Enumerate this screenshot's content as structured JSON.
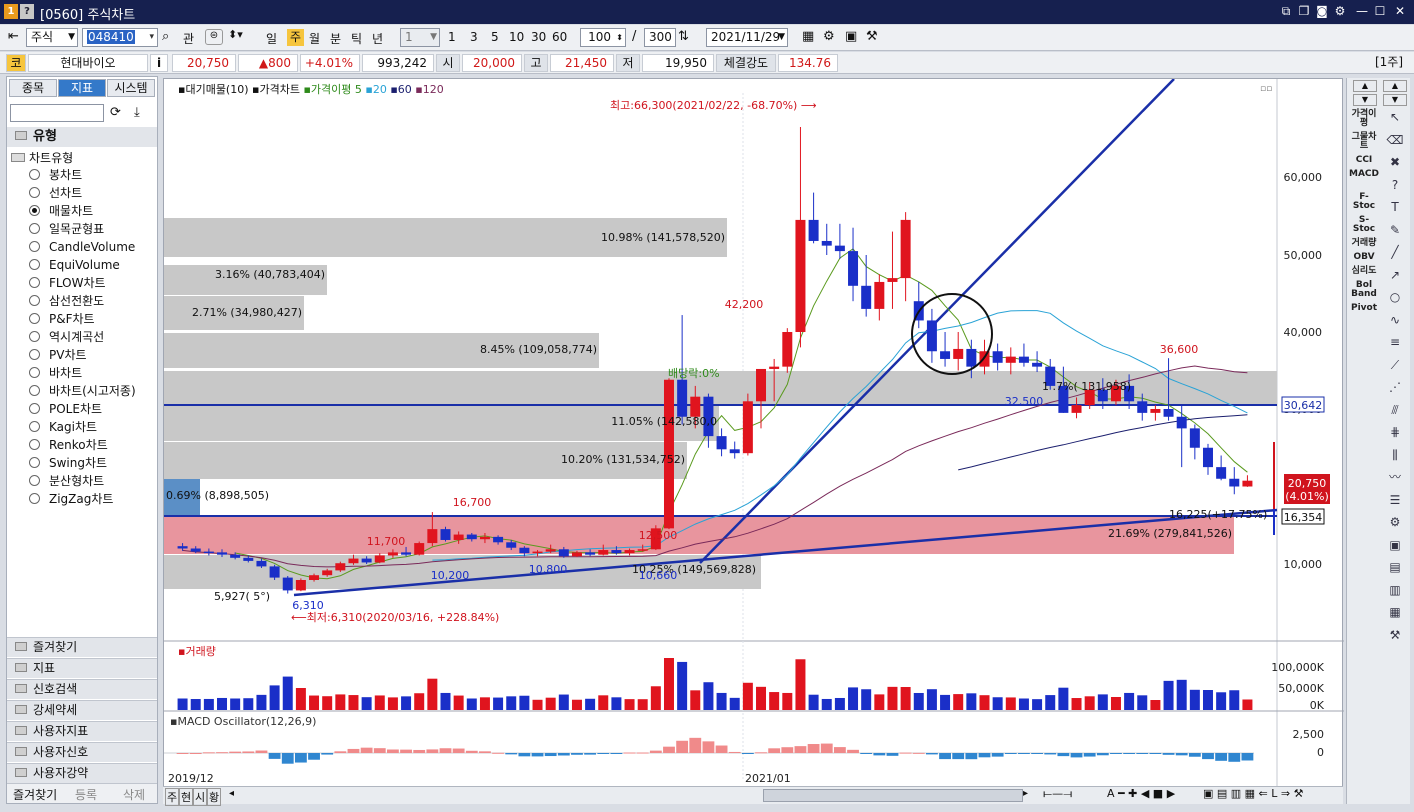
{
  "title": {
    "badge1": "1",
    "badge2": "?",
    "text": "[0560] 주식차트"
  },
  "toolbar": {
    "market": "주식",
    "code": "048410",
    "kwan": "관",
    "periods": [
      "일",
      "주",
      "월",
      "분",
      "틱",
      "년"
    ],
    "unit": "1",
    "quick": [
      "1",
      "3",
      "5",
      "10",
      "30",
      "60"
    ],
    "count": "100",
    "slash": "/",
    "total": "300",
    "date": "2021/11/29"
  },
  "quote": {
    "co_label": "코",
    "name": "현대바이오",
    "info": "i",
    "price": "20,750",
    "change": "▲800",
    "rate": "+4.01%",
    "volume": "993,242",
    "open_label": "시",
    "open": "20,000",
    "high_label": "고",
    "high": "21,450",
    "low_label": "저",
    "low": "19,950",
    "strength_label": "체결강도",
    "strength": "134.76",
    "period_tag": "[1주]"
  },
  "left": {
    "tabs": [
      "종목",
      "지표",
      "시스템"
    ],
    "section": "유형",
    "group": "차트유형",
    "items": [
      "봉차트",
      "선차트",
      "매물차트",
      "일목균형표",
      "CandleVolume",
      "EquiVolume",
      "FLOW차트",
      "삼선전환도",
      "P&F차트",
      "역시계곡선",
      "PV차트",
      "바차트",
      "바차트(시고저종)",
      "POLE차트",
      "Kagi차트",
      "Renko차트",
      "Swing차트",
      "분산형차트",
      "ZigZag차트"
    ],
    "selected": "매물차트",
    "folders": [
      "즐겨찾기",
      "지표",
      "신호검색",
      "강세약세",
      "사용자지표",
      "사용자신호",
      "사용자강약"
    ],
    "bottom": [
      "즐겨찾기",
      "등록",
      "삭제"
    ]
  },
  "chart": {
    "legend": [
      "대기매물(10)",
      "가격차트",
      "가격이평 5",
      "20",
      "60",
      "120"
    ],
    "high_note": "최고:66,300(2021/02/22, -68.70%)",
    "low_note": "최저:6,310(2020/03/16, +228.84%)",
    "dividend": "배당락:0%",
    "y_labels": [
      "60,000",
      "50,000",
      "40,000",
      "30,000",
      "10,000"
    ],
    "ann": [
      "42,200",
      "36,600",
      "32,500",
      "16,700",
      "11,700",
      "12,500",
      "10,200",
      "10,800",
      "10,660",
      "6,310"
    ],
    "vol_blocks": [
      {
        "pct": "21.69%",
        "amt": "(279,841,526)",
        "color": "#e8959e"
      },
      {
        "pct": "10.20%",
        "amt": "(131,534,752)",
        "color": "#c8c8c8"
      },
      {
        "pct": "10.98%",
        "amt": "(141,578,520)",
        "color": "#c8c8c8"
      },
      {
        "pct": "3.16%",
        "amt": "(40,783,404)",
        "color": "#c8c8c8"
      },
      {
        "pct": "2.71%",
        "amt": "(34,980,427)",
        "color": "#c8c8c8"
      },
      {
        "pct": "8.45%",
        "amt": "(109,058,774)",
        "color": "#c8c8c8"
      },
      {
        "pct": "11.05%",
        "amt": "(142,580,0",
        "color": "#c8c8c8"
      },
      {
        "pct": "0.69%",
        "amt": "(8,898,505)",
        "color": "#5b8fc6"
      },
      {
        "pct": "10.25%",
        "amt": "(149,569,828)",
        "color": "#c8c8c8"
      }
    ],
    "mid_block": "1 .7%( 131,958)",
    "lowest_vol": "5,927(  5°)",
    "hline_label": "30,642",
    "trend_label": "16,354",
    "price_tag": "20,750",
    "price_tag2": "(4.01%)",
    "trend_note": "16,225(+17.75%)",
    "volume_title": "거래량",
    "vol_axis": [
      "100,000K",
      "50,000K",
      "0K"
    ],
    "macd_title": "MACD Oscillator(12,26,9)",
    "macd_axis": [
      "2,500",
      "0"
    ],
    "x_labels": [
      "2019/12",
      "2021/01"
    ],
    "bottom_tabs": [
      "주",
      "현",
      "시",
      "황"
    ]
  },
  "right": {
    "indicators": [
      "가격이평",
      "그물차트",
      "CCI",
      "MACD",
      "F-Stoc",
      "S-Stoc",
      "거래량",
      "OBV",
      "심리도",
      "Bol Band",
      "Pivot"
    ]
  },
  "chart_data": {
    "type": "candlestick",
    "x_range": [
      "2019/12",
      "2021/11"
    ],
    "y_range": [
      5000,
      66300
    ],
    "ohlc_weekly_approx": [
      [
        12300,
        12700,
        11700,
        12000
      ],
      [
        12000,
        12300,
        11400,
        11600
      ],
      [
        11600,
        12000,
        11100,
        11500
      ],
      [
        11500,
        11900,
        10900,
        11200
      ],
      [
        11200,
        11500,
        10600,
        10800
      ],
      [
        10800,
        11100,
        10200,
        10400
      ],
      [
        10400,
        10700,
        9500,
        9700
      ],
      [
        9700,
        9900,
        8000,
        8300
      ],
      [
        8300,
        8500,
        6310,
        6700
      ],
      [
        6700,
        8200,
        6600,
        8000
      ],
      [
        8000,
        8800,
        7800,
        8600
      ],
      [
        8600,
        9400,
        8400,
        9200
      ],
      [
        9200,
        10300,
        9000,
        10100
      ],
      [
        10100,
        11200,
        9900,
        10700
      ],
      [
        10700,
        11000,
        10000,
        10200
      ],
      [
        10200,
        11400,
        10100,
        11100
      ],
      [
        11100,
        11900,
        10800,
        11500
      ],
      [
        11500,
        12200,
        11000,
        11200
      ],
      [
        11200,
        12900,
        11100,
        12700
      ],
      [
        12700,
        16700,
        12300,
        14500
      ],
      [
        14500,
        14800,
        12900,
        13100
      ],
      [
        13100,
        14200,
        12600,
        13800
      ],
      [
        13800,
        14000,
        12900,
        13200
      ],
      [
        13200,
        14000,
        12700,
        13500
      ],
      [
        13500,
        13700,
        12500,
        12800
      ],
      [
        12800,
        13100,
        11800,
        12100
      ],
      [
        12100,
        12300,
        11000,
        11400
      ],
      [
        11400,
        11800,
        11000,
        11600
      ],
      [
        11600,
        12500,
        11400,
        11900
      ],
      [
        11900,
        12200,
        10800,
        11000
      ],
      [
        11000,
        11700,
        10900,
        11500
      ],
      [
        11500,
        11900,
        11000,
        11200
      ],
      [
        11200,
        12500,
        11100,
        11800
      ],
      [
        11800,
        12300,
        11200,
        11400
      ],
      [
        11400,
        12000,
        11100,
        11800
      ],
      [
        11800,
        12500,
        11600,
        11900
      ],
      [
        11900,
        15000,
        11800,
        14600
      ],
      [
        14600,
        34000,
        14500,
        33800
      ],
      [
        33800,
        42200,
        28000,
        29000
      ],
      [
        29000,
        33000,
        27500,
        31600
      ],
      [
        31600,
        32000,
        25000,
        26500
      ],
      [
        26500,
        27500,
        23900,
        24800
      ],
      [
        24800,
        25800,
        23600,
        24300
      ],
      [
        24300,
        32000,
        24000,
        31000
      ],
      [
        31000,
        35000,
        27500,
        35200
      ],
      [
        35200,
        36500,
        31000,
        35500
      ],
      [
        35500,
        40500,
        34700,
        40000
      ],
      [
        40000,
        66300,
        38000,
        54500
      ],
      [
        54500,
        58000,
        51500,
        51800
      ],
      [
        51800,
        54000,
        50000,
        51200
      ],
      [
        51200,
        54000,
        49500,
        50500
      ],
      [
        50500,
        53500,
        44000,
        46000
      ],
      [
        46000,
        50000,
        42000,
        43000
      ],
      [
        43000,
        47500,
        41500,
        46500
      ],
      [
        46500,
        53000,
        43000,
        47000
      ],
      [
        47000,
        55500,
        44000,
        54500
      ],
      [
        44000,
        46500,
        40500,
        41500
      ],
      [
        41500,
        43000,
        36000,
        37500
      ],
      [
        37500,
        40000,
        35500,
        36500
      ],
      [
        36500,
        40000,
        35000,
        37800
      ],
      [
        37800,
        39000,
        34000,
        35500
      ],
      [
        35500,
        39000,
        34500,
        37500
      ],
      [
        37500,
        38500,
        35000,
        36000
      ],
      [
        36000,
        38000,
        34500,
        36800
      ],
      [
        36800,
        38500,
        35500,
        36000
      ],
      [
        36000,
        37500,
        34800,
        35500
      ],
      [
        35500,
        36500,
        32500,
        33000
      ],
      [
        33000,
        35500,
        29500,
        29500
      ],
      [
        29500,
        31500,
        28800,
        30500
      ],
      [
        30500,
        33500,
        30000,
        32500
      ],
      [
        32500,
        34000,
        30000,
        31000
      ],
      [
        31000,
        33800,
        30500,
        33000
      ],
      [
        33000,
        34500,
        30000,
        31000
      ],
      [
        31000,
        32000,
        28500,
        29500
      ],
      [
        29500,
        30500,
        28500,
        30000
      ],
      [
        30000,
        36600,
        28500,
        29000
      ],
      [
        29000,
        30500,
        22500,
        27500
      ],
      [
        27500,
        28000,
        23500,
        25000
      ],
      [
        25000,
        25500,
        21500,
        22500
      ],
      [
        22500,
        24000,
        20800,
        21000
      ],
      [
        21000,
        22500,
        19000,
        20000
      ],
      [
        20000,
        21450,
        19950,
        20750
      ]
    ]
  }
}
